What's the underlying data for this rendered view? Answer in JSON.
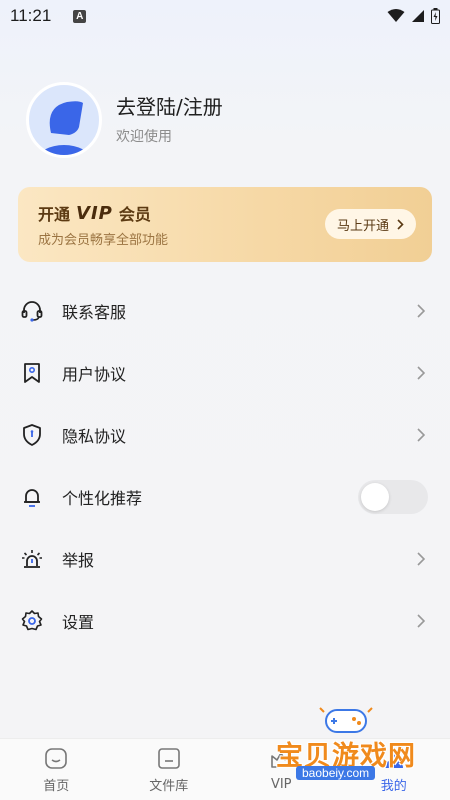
{
  "status_bar": {
    "time": "11:21",
    "a_badge": "A"
  },
  "profile": {
    "title": "去登陆/注册",
    "subtitle": "欢迎使用"
  },
  "vip_card": {
    "prefix": "开通",
    "logo": "VIP",
    "suffix": "会员",
    "subtitle": "成为会员畅享全部功能",
    "button_label": "马上开通"
  },
  "menu": {
    "items": [
      {
        "label": "联系客服",
        "icon": "headset-icon"
      },
      {
        "label": "用户协议",
        "icon": "bookmark-icon"
      },
      {
        "label": "隐私协议",
        "icon": "shield-icon"
      },
      {
        "label": "个性化推荐",
        "icon": "bell-icon",
        "toggle": false
      },
      {
        "label": "举报",
        "icon": "alarm-icon"
      },
      {
        "label": "设置",
        "icon": "gear-icon"
      }
    ]
  },
  "tabbar": {
    "tabs": [
      {
        "label": "首页"
      },
      {
        "label": "文件库"
      },
      {
        "label": "VIP"
      },
      {
        "label": "我的"
      }
    ]
  },
  "watermark": {
    "text": "宝贝游戏网",
    "url": "baobeiy.com"
  },
  "colors": {
    "accent": "#3a66e8",
    "vip_gold": "#f6d8a5",
    "watermark_orange": "#f08a1c"
  }
}
